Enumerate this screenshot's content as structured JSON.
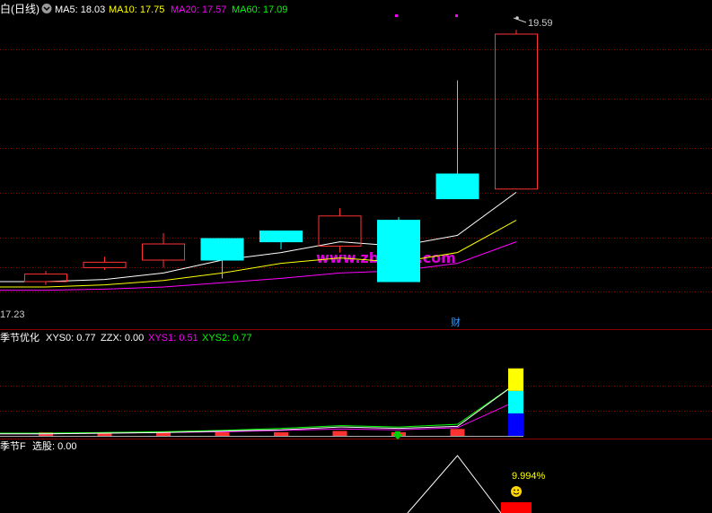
{
  "main_panel": {
    "title": "白(日线)",
    "indicators": [
      {
        "label": "MA5: 18.03",
        "color": "#ffffff"
      },
      {
        "label": "MA10: 17.75",
        "color": "#ffff00"
      },
      {
        "label": "MA20: 17.57",
        "color": "#ff00ff"
      },
      {
        "label": "MA60: 17.09",
        "color": "#00ff00"
      }
    ],
    "high_label": "19.59",
    "low_label": "17.23",
    "event_mark": "财",
    "watermark": "www.zbzfwu.com"
  },
  "sub_panel_1": {
    "title": "季节优化",
    "indicators": [
      {
        "label": "XYS0: 0.77",
        "color": "#ffffff"
      },
      {
        "label": "ZZX: 0.00",
        "color": "#ffffff"
      },
      {
        "label": "XYS1: 0.51",
        "color": "#ff00ff"
      },
      {
        "label": "XYS2: 0.77",
        "color": "#00ff00"
      }
    ]
  },
  "sub_panel_2": {
    "title": "季节F",
    "indicators": [
      {
        "label": "选股: 0.00",
        "color": "#ffffff"
      }
    ],
    "value_label": "9.994%"
  },
  "colors": {
    "up": "#ff3232",
    "down": "#00ffff",
    "ma5": "#ffffff",
    "ma10": "#ffff00",
    "ma20": "#ff00ff",
    "ma60": "#00ff00",
    "grid": "#8b0000"
  },
  "chart_data": {
    "type": "candlestick",
    "ylim": [
      17.0,
      19.7
    ],
    "candles": [
      {
        "open": 17.25,
        "close": 17.32,
        "high": 17.35,
        "low": 17.22
      },
      {
        "open": 17.38,
        "close": 17.43,
        "high": 17.48,
        "low": 17.36
      },
      {
        "open": 17.45,
        "close": 17.6,
        "high": 17.7,
        "low": 17.38
      },
      {
        "open": 17.65,
        "close": 17.45,
        "high": 17.65,
        "low": 17.28
      },
      {
        "open": 17.72,
        "close": 17.62,
        "high": 17.72,
        "low": 17.55
      },
      {
        "open": 17.58,
        "close": 17.86,
        "high": 17.93,
        "low": 17.52
      },
      {
        "open": 17.82,
        "close": 17.25,
        "high": 17.85,
        "low": 17.25
      },
      {
        "open": 18.25,
        "close": 18.02,
        "high": 19.12,
        "low": 18.02
      },
      {
        "open": 18.11,
        "close": 19.55,
        "high": 19.59,
        "low": 18.11
      }
    ],
    "ma5": [
      17.25,
      17.27,
      17.33,
      17.45,
      17.52,
      17.62,
      17.58,
      17.68,
      18.08
    ],
    "ma10": [
      17.2,
      17.22,
      17.26,
      17.33,
      17.42,
      17.47,
      17.43,
      17.52,
      17.82
    ],
    "ma20": [
      17.17,
      17.18,
      17.2,
      17.24,
      17.28,
      17.33,
      17.35,
      17.42,
      17.62
    ],
    "sub1": {
      "xys0": [
        0.03,
        0.04,
        0.05,
        0.07,
        0.09,
        0.13,
        0.11,
        0.14,
        0.77
      ],
      "xys1": [
        0.03,
        0.04,
        0.05,
        0.06,
        0.08,
        0.1,
        0.09,
        0.12,
        0.51
      ],
      "xys2": [
        0.04,
        0.05,
        0.06,
        0.08,
        0.11,
        0.15,
        0.13,
        0.17,
        0.77
      ],
      "bars": [
        0.02,
        0.03,
        0.04,
        0.05,
        0.06,
        0.1,
        0.06,
        0.14,
        0
      ],
      "stack": [
        0.38,
        0.38,
        0.38
      ]
    },
    "sub2": {
      "peak": 1.0,
      "last_bar": 0.12
    }
  }
}
